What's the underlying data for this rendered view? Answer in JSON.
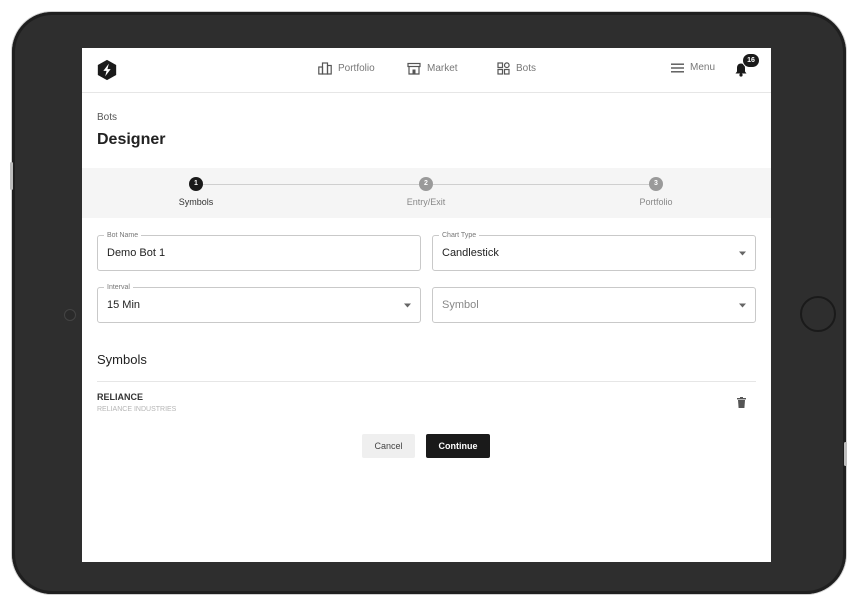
{
  "nav": {
    "items": [
      {
        "label": "Portfolio",
        "icon": "building-icon"
      },
      {
        "label": "Market",
        "icon": "store-icon"
      },
      {
        "label": "Bots",
        "icon": "grid-icon"
      }
    ],
    "menu_label": "Menu",
    "notification_count": "16"
  },
  "page": {
    "breadcrumb": "Bots",
    "title": "Designer"
  },
  "stepper": {
    "steps": [
      {
        "number": "1",
        "label": "Symbols",
        "active": true
      },
      {
        "number": "2",
        "label": "Entry/Exit",
        "active": false
      },
      {
        "number": "3",
        "label": "Portfolio",
        "active": false
      }
    ]
  },
  "form": {
    "bot_name": {
      "label": "Bot Name",
      "value": "Demo Bot 1"
    },
    "chart_type": {
      "label": "Chart Type",
      "value": "Candlestick"
    },
    "interval": {
      "label": "Interval",
      "value": "15 Min"
    },
    "symbol": {
      "placeholder": "Symbol"
    }
  },
  "symbols": {
    "title": "Symbols",
    "items": [
      {
        "name": "RELIANCE",
        "description": "RELIANCE INDUSTRIES"
      }
    ]
  },
  "actions": {
    "cancel_label": "Cancel",
    "continue_label": "Continue"
  },
  "colors": {
    "active": "#1a1a1a",
    "inactive": "#9a9a9a",
    "device_frame": "#2e2e2e"
  }
}
